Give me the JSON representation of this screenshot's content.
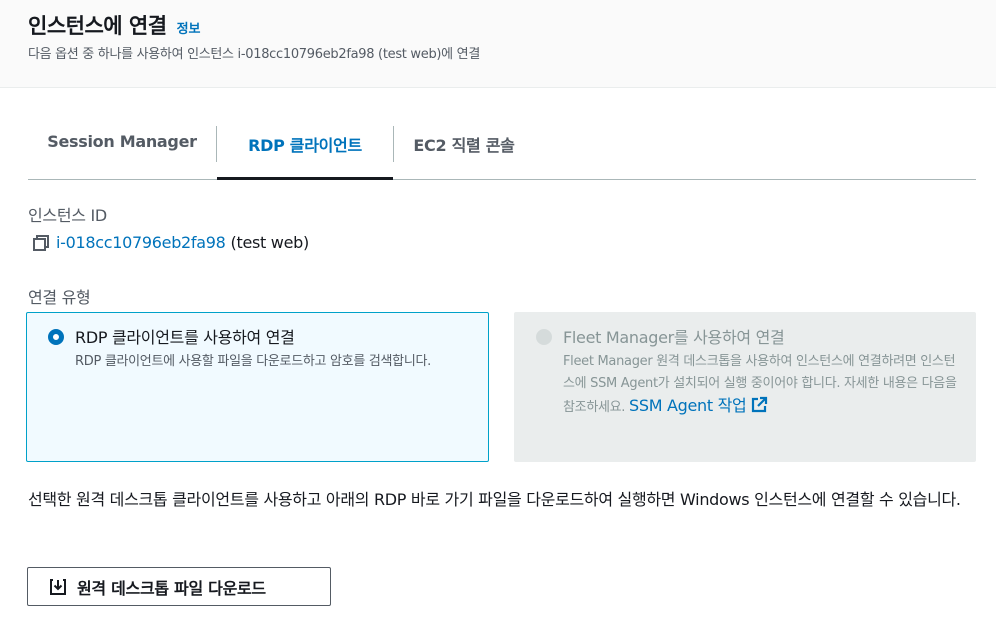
{
  "header": {
    "title": "인스턴스에 연결",
    "info_link": "정보",
    "subtitle": "다음 옵션 중 하나를 사용하여 인스턴스 i-018cc10796eb2fa98 (test web)에 연결"
  },
  "tabs": [
    {
      "label": "Session Manager",
      "active": false
    },
    {
      "label": "RDP 클라이언트",
      "active": true
    },
    {
      "label": "EC2 직렬 콘솔",
      "active": false
    }
  ],
  "instance": {
    "label": "인스턴스 ID",
    "id": "i-018cc10796eb2fa98",
    "name": "(test web)"
  },
  "connection_type": {
    "label": "연결 유형",
    "options": [
      {
        "title": "RDP 클라이언트를 사용하여 연결",
        "description": "RDP 클라이언트에 사용할 파일을 다운로드하고 암호를 검색합니다.",
        "selected": true,
        "disabled": false
      },
      {
        "title": "Fleet Manager를 사용하여 연결",
        "description": "Fleet Manager 원격 데스크톱을 사용하여 인스턴스에 연결하려면 인스턴스에 SSM Agent가 설치되어 실행 중이어야 합니다. 자세한 내용은 다음을 참조하세요.",
        "link": "SSM Agent 작업",
        "selected": false,
        "disabled": true
      }
    ]
  },
  "description": "선택한 원격 데스크톱 클라이언트를 사용하고 아래의 RDP 바로 가기 파일을 다운로드하여 실행하면 Windows 인스턴스에 연결할 수 있습니다.",
  "download_button": "원격 데스크톱 파일 다운로드",
  "colors": {
    "accent": "#0073bb",
    "selected_border": "#00a1c9",
    "selected_bg": "#f1faff",
    "disabled_bg": "#eaeded"
  }
}
